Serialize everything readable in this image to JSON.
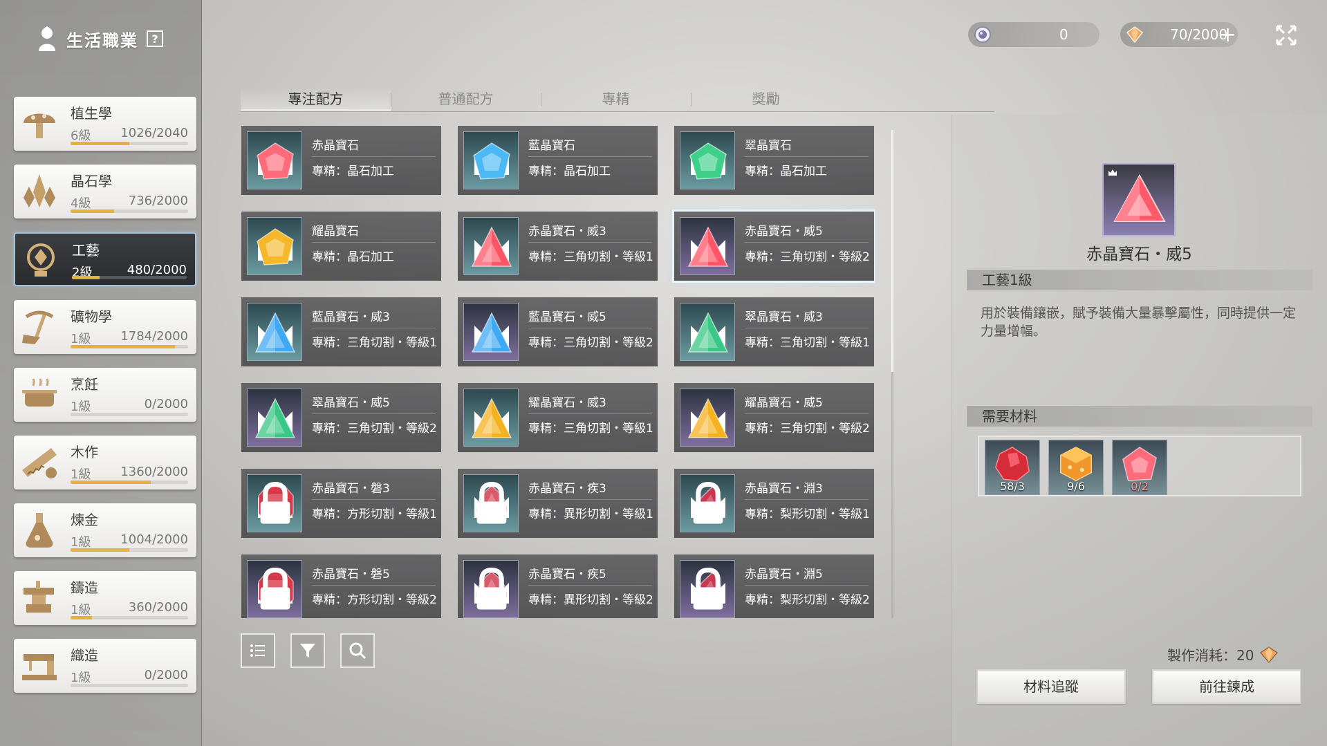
{
  "sidebar": {
    "title": "生活職業",
    "help_label": "?",
    "professions": [
      {
        "name": "植生學",
        "level": "6級",
        "exp": "1026/2040",
        "progress": 0.5,
        "icon": "mushroom-icon"
      },
      {
        "name": "晶石學",
        "level": "4級",
        "exp": "736/2000",
        "progress": 0.37,
        "icon": "crystal-cluster-icon"
      },
      {
        "name": "工藝",
        "level": "2級",
        "exp": "480/2000",
        "progress": 0.24,
        "icon": "gem-craft-icon",
        "active": true
      },
      {
        "name": "礦物學",
        "level": "1級",
        "exp": "1784/2000",
        "progress": 0.89,
        "icon": "pickaxe-icon"
      },
      {
        "name": "烹飪",
        "level": "1級",
        "exp": "0/2000",
        "progress": 0.0,
        "icon": "cooking-pot-icon"
      },
      {
        "name": "木作",
        "level": "1級",
        "exp": "1360/2000",
        "progress": 0.68,
        "icon": "saw-icon"
      },
      {
        "name": "煉金",
        "level": "1級",
        "exp": "1004/2000",
        "progress": 0.5,
        "icon": "flask-icon"
      },
      {
        "name": "鑄造",
        "level": "1級",
        "exp": "360/2000",
        "progress": 0.18,
        "icon": "anvil-icon"
      },
      {
        "name": "織造",
        "level": "1級",
        "exp": "0/2000",
        "progress": 0.0,
        "icon": "sewing-machine-icon"
      }
    ]
  },
  "topbar": {
    "currency1": {
      "value": "0",
      "icon": "orb-coin-icon"
    },
    "currency2": {
      "value": "70/2000",
      "icon": "energy-gem-icon",
      "plus_label": "+"
    }
  },
  "tabs": [
    "專注配方",
    "普通配方",
    "專精",
    "獎勵"
  ],
  "recipes": [
    {
      "name": "赤晶寶石",
      "desc": "專精：晶石加工",
      "color": "#ff6b7a",
      "shape": "square",
      "bg": "g-teal"
    },
    {
      "name": "藍晶寶石",
      "desc": "專精：晶石加工",
      "color": "#4cb8f5",
      "shape": "square",
      "bg": "g-teal"
    },
    {
      "name": "翠晶寶石",
      "desc": "專精：晶石加工",
      "color": "#3ecf8a",
      "shape": "square",
      "bg": "g-teal"
    },
    {
      "name": "耀晶寶石",
      "desc": "專精：晶石加工",
      "color": "#f5b82a",
      "shape": "square",
      "bg": "g-teal"
    },
    {
      "name": "赤晶寶石・威3",
      "desc": "專精：三角切割・等級1",
      "color": "#ff5566",
      "shape": "triangle",
      "bg": "g-teal"
    },
    {
      "name": "赤晶寶石・威5",
      "desc": "專精：三角切割・等級2",
      "color": "#ff5566",
      "shape": "triangle",
      "bg": "g-purple",
      "selected": true
    },
    {
      "name": "藍晶寶石・威3",
      "desc": "專精：三角切割・等級1",
      "color": "#3fa9f5",
      "shape": "triangle",
      "bg": "g-teal"
    },
    {
      "name": "藍晶寶石・威5",
      "desc": "專精：三角切割・等級2",
      "color": "#3fa9f5",
      "shape": "triangle",
      "bg": "g-purple"
    },
    {
      "name": "翠晶寶石・威3",
      "desc": "專精：三角切割・等級1",
      "color": "#38c785",
      "shape": "triangle",
      "bg": "g-teal"
    },
    {
      "name": "翠晶寶石・威5",
      "desc": "專精：三角切割・等級2",
      "color": "#38c785",
      "shape": "triangle",
      "bg": "g-purple"
    },
    {
      "name": "耀晶寶石・威3",
      "desc": "專精：三角切割・等級1",
      "color": "#f5b21f",
      "shape": "triangle",
      "bg": "g-teal"
    },
    {
      "name": "耀晶寶石・威5",
      "desc": "專精：三角切割・等級2",
      "color": "#f5b21f",
      "shape": "triangle",
      "bg": "g-purple"
    },
    {
      "name": "赤晶寶石・磐3",
      "desc": "專精：方形切割・等級1",
      "color": "#d8394a",
      "shape": "octagon",
      "bg": "g-teal",
      "locked": true
    },
    {
      "name": "赤晶寶石・疾3",
      "desc": "專精：異形切割・等級1",
      "color": "#d85a6a",
      "shape": "drop",
      "bg": "g-teal",
      "locked": true
    },
    {
      "name": "赤晶寶石・淵3",
      "desc": "專精：梨形切割・等級1",
      "color": "#c8384e",
      "shape": "pear",
      "bg": "g-teal",
      "locked": true
    },
    {
      "name": "赤晶寶石・磐5",
      "desc": "專精：方形切割・等級2",
      "color": "#d8394a",
      "shape": "octagon",
      "bg": "g-purple",
      "locked": true
    },
    {
      "name": "赤晶寶石・疾5",
      "desc": "專精：異形切割・等級2",
      "color": "#d85a6a",
      "shape": "drop",
      "bg": "g-purple",
      "locked": true
    },
    {
      "name": "赤晶寶石・淵5",
      "desc": "專精：梨形切割・等級2",
      "color": "#c8384e",
      "shape": "pear",
      "bg": "g-purple",
      "locked": true
    }
  ],
  "detail": {
    "title": "赤晶寶石・威5",
    "requirement": "工藝1級",
    "description": "用於裝備鑲嵌，賦予裝備大量暴擊屬性，同時提供一定力量增幅。",
    "materials_header": "需要材料",
    "materials": [
      {
        "count": "58/3",
        "icon": "red-ore-icon",
        "short": false
      },
      {
        "count": "9/6",
        "icon": "amber-cube-icon",
        "short": false
      },
      {
        "count": "0/2",
        "icon": "red-gem-icon",
        "short": true
      }
    ],
    "cost_label": "製作消耗：20",
    "buttons": {
      "track": "材料追蹤",
      "craft": "前往鍊成"
    }
  }
}
